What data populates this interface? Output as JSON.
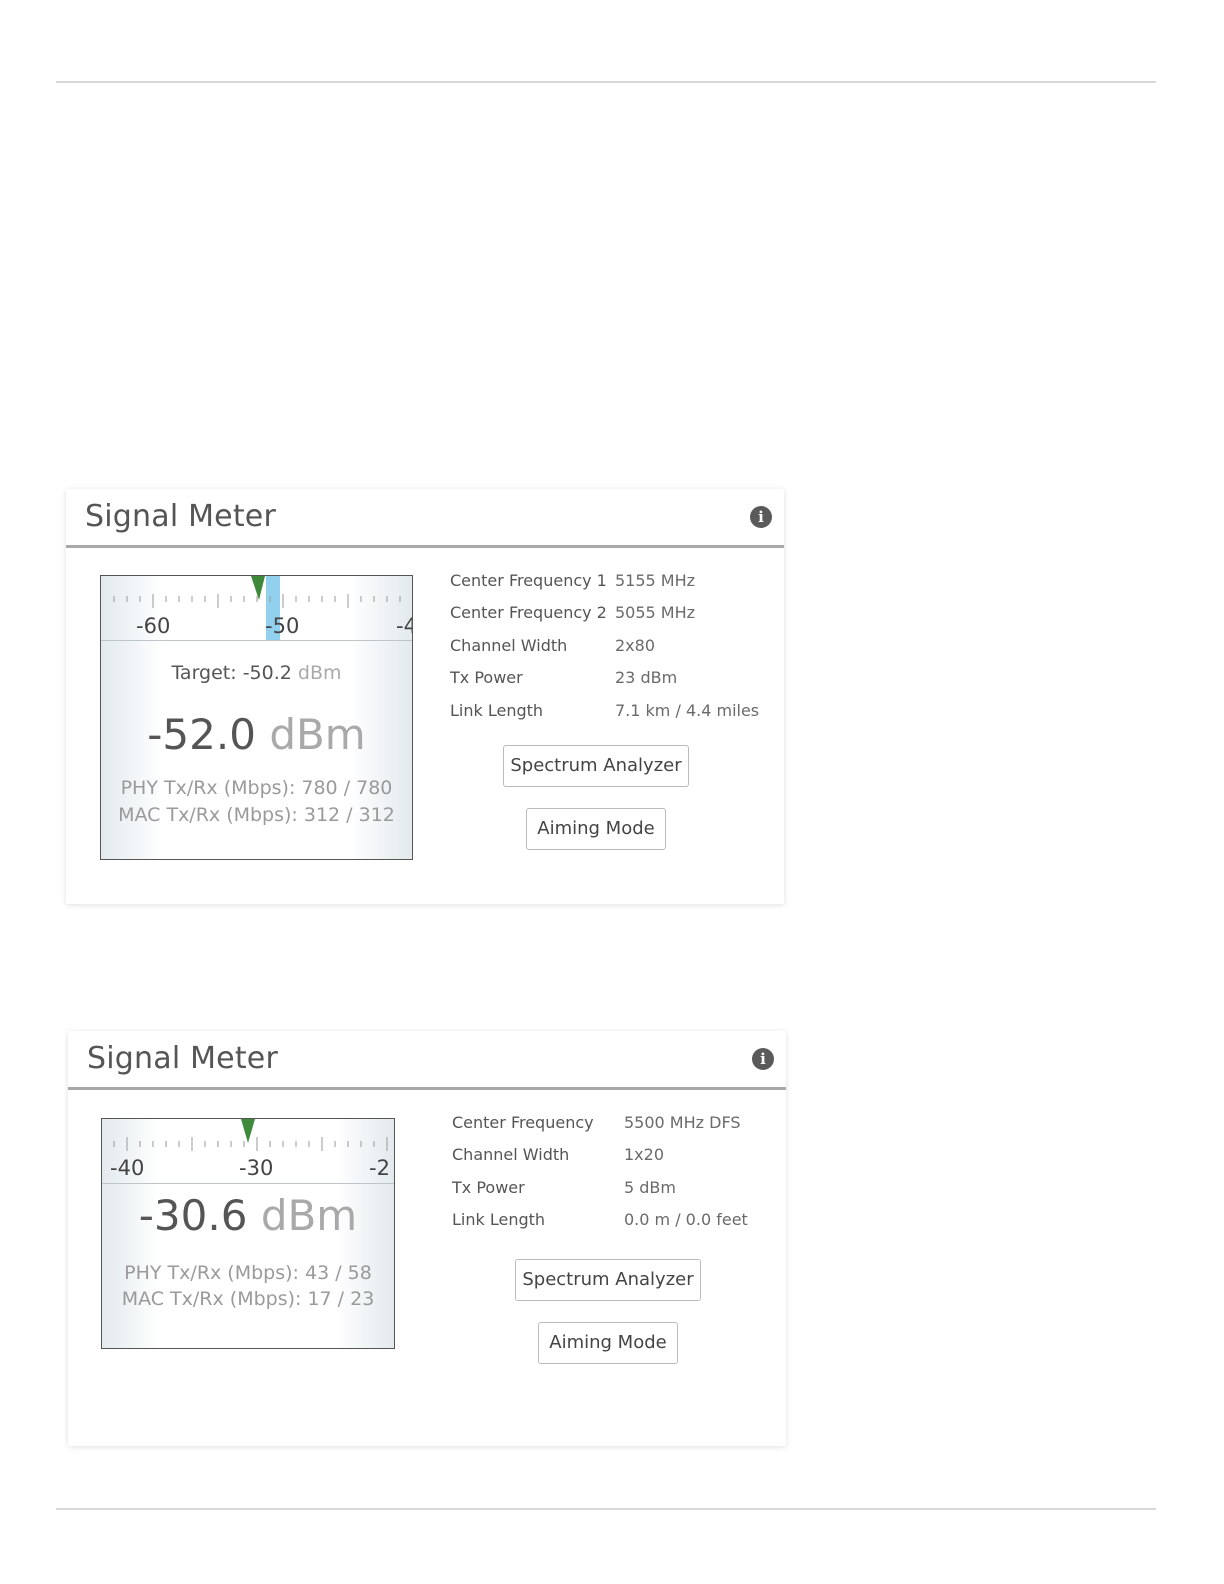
{
  "panels": [
    {
      "title": "Signal Meter",
      "meter": {
        "scale_labels": [
          "-60",
          "-50",
          "-4"
        ],
        "target_prefix": "Target: -50.2",
        "target_unit": "dBm",
        "value": "-52.0",
        "value_unit": "dBm",
        "phy": "PHY Tx/Rx (Mbps): 780 / 780",
        "mac": "MAC Tx/Rx (Mbps): 312 / 312"
      },
      "properties": [
        {
          "label": "Center Frequency 1",
          "value": "5155 MHz"
        },
        {
          "label": "Center Frequency 2",
          "value": "5055 MHz"
        },
        {
          "label": "Channel Width",
          "value": "2x80"
        },
        {
          "label": "Tx Power",
          "value": "23 dBm"
        },
        {
          "label": "Link Length",
          "value": "7.1 km / 4.4 miles"
        }
      ],
      "buttons": {
        "spectrum": "Spectrum Analyzer",
        "aiming": "Aiming Mode"
      }
    },
    {
      "title": "Signal Meter",
      "meter": {
        "scale_labels": [
          "-40",
          "-30",
          "-2"
        ],
        "value": "-30.6",
        "value_unit": "dBm",
        "phy": "PHY Tx/Rx (Mbps): 43 / 58",
        "mac": "MAC Tx/Rx (Mbps): 17 / 23"
      },
      "properties": [
        {
          "label": "Center Frequency",
          "value": "5500 MHz DFS"
        },
        {
          "label": "Channel Width",
          "value": "1x20"
        },
        {
          "label": "Tx Power",
          "value": "5 dBm"
        },
        {
          "label": "Link Length",
          "value": "0.0 m / 0.0 feet"
        }
      ],
      "buttons": {
        "spectrum": "Spectrum Analyzer",
        "aiming": "Aiming Mode"
      }
    }
  ]
}
